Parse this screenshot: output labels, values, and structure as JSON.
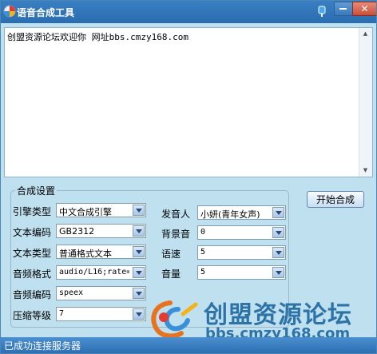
{
  "window": {
    "title": "语音合成工具"
  },
  "text_area": {
    "content": "创盟资源论坛欢迎你 网址bbs.cmzy168.com"
  },
  "settings": {
    "group_title": "合成设置",
    "engine_type": {
      "label": "引擎类型",
      "value": "中文合成引擎"
    },
    "text_encoding": {
      "label": "文本编码",
      "value": "GB2312"
    },
    "text_type": {
      "label": "文本类型",
      "value": "普通格式文本"
    },
    "audio_format": {
      "label": "音频格式",
      "value": "audio/L16;rate="
    },
    "audio_encoding": {
      "label": "音频编码",
      "value": "speex"
    },
    "compression_level": {
      "label": "压缩等级",
      "value": "7"
    },
    "speaker": {
      "label": "发音人",
      "value": "小妍(青年女声)"
    },
    "background_sound": {
      "label": "背景音",
      "value": "0"
    },
    "speed": {
      "label": "语速",
      "value": "5"
    },
    "volume": {
      "label": "音量",
      "value": "5"
    }
  },
  "buttons": {
    "start": "开始合成"
  },
  "watermark": {
    "name": "创盟资源论坛",
    "url": "bbs.cmzy168.com"
  },
  "status_bar": {
    "text": "已成功连接服务器"
  },
  "icons": {
    "app": "app-logo-icon",
    "pin": "pin-icon",
    "minimize": "minimize-icon",
    "close": "close-icon"
  },
  "colors": {
    "title_bar": "#2a6db0",
    "background": "#bfe0ef",
    "status_bar": "#2d6fb2",
    "watermark_blue": "#2d73a8"
  }
}
